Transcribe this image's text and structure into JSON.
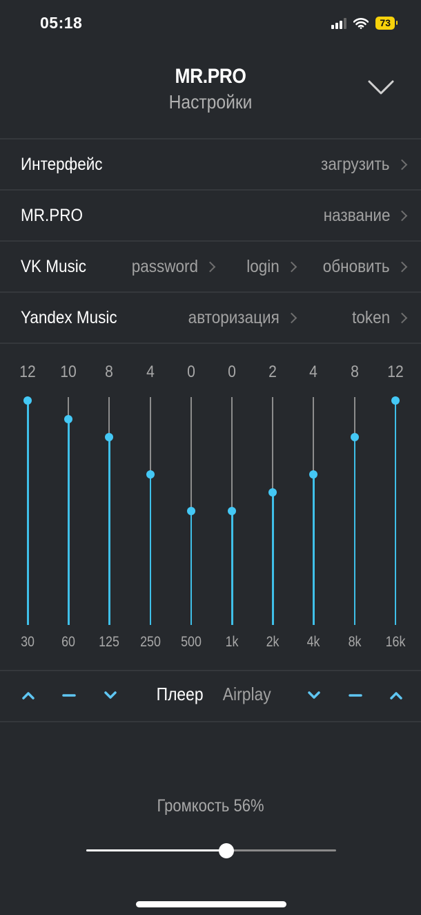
{
  "status_bar": {
    "time": "05:18",
    "battery": "73",
    "signal_bars": 3,
    "signal_bars_total": 4,
    "icons": [
      "cellular-signal-icon",
      "wifi-icon",
      "battery-icon"
    ]
  },
  "header": {
    "title": "MR.PRO",
    "subtitle": "Настройки",
    "collapse_icon": "chevron-down-icon"
  },
  "settings": {
    "interface": {
      "label": "Интерфейс",
      "action": "загрузить"
    },
    "mrpro": {
      "label": "MR.PRO",
      "action": "название"
    },
    "vk": {
      "label": "VK Music",
      "actions": [
        "password",
        "login",
        "обновить"
      ]
    },
    "yandex": {
      "label": "Yandex Music",
      "actions": [
        "авторизация",
        "token"
      ]
    }
  },
  "equalizer": {
    "range": [
      -12,
      12
    ],
    "accent_color": "#44c8f5",
    "bands": [
      {
        "freq": "30",
        "value": 12
      },
      {
        "freq": "60",
        "value": 10
      },
      {
        "freq": "125",
        "value": 8
      },
      {
        "freq": "250",
        "value": 4
      },
      {
        "freq": "500",
        "value": 0
      },
      {
        "freq": "1k",
        "value": 0
      },
      {
        "freq": "2k",
        "value": 2
      },
      {
        "freq": "4k",
        "value": 4
      },
      {
        "freq": "8k",
        "value": 8
      },
      {
        "freq": "16k",
        "value": 12
      }
    ]
  },
  "controls": {
    "left": [
      "chevron-up-icon",
      "minus-icon",
      "chevron-down-icon"
    ],
    "right": [
      "chevron-down-icon",
      "minus-icon",
      "chevron-up-icon"
    ],
    "player_label": "Плеер",
    "airplay_label": "Airplay"
  },
  "volume": {
    "label": "Громкость 56%",
    "percent": 56
  }
}
